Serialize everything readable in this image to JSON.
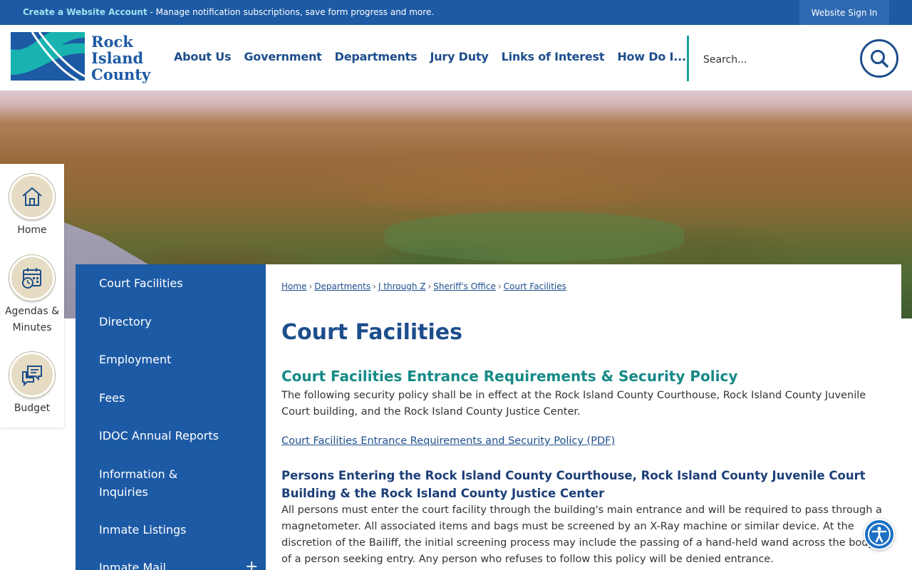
{
  "topbar": {
    "create_account_link": "Create a Website Account",
    "create_account_desc": " - Manage notification subscriptions, save form progress and more.",
    "sign_in": "Website Sign In"
  },
  "logo": {
    "line1": "Rock",
    "line2": "Island",
    "line3": "County"
  },
  "nav": {
    "items": [
      "About Us",
      "Government",
      "Departments",
      "Jury Duty",
      "Links of Interest",
      "How Do I..."
    ]
  },
  "search": {
    "placeholder": "Search...",
    "icon": "search-icon"
  },
  "quick_links": [
    {
      "label": "Home",
      "icon": "home-icon"
    },
    {
      "label": "Agendas & Minutes",
      "icon": "calendar-clock-icon"
    },
    {
      "label": "Budget",
      "icon": "chat-bubbles-icon"
    }
  ],
  "sidenav": {
    "items": [
      "Court Facilities",
      "Directory",
      "Employment",
      "Fees",
      "IDOC Annual Reports",
      "Information & Inquiries",
      "Inmate Listings",
      "Inmate Mail"
    ],
    "expand_symbol": "+"
  },
  "breadcrumb": {
    "items": [
      "Home",
      "Departments",
      "J through Z",
      "Sheriff's Office",
      "Court Facilities"
    ],
    "separator": "›"
  },
  "content": {
    "title": "Court Facilities",
    "section_heading": "Court Facilities Entrance Requirements & Security Policy",
    "intro": "The following security policy shall be in effect at the Rock Island County Courthouse, Rock Island County Juvenile Court building, and the Rock Island County Justice Center.",
    "pdf_link": "Court Facilities Entrance Requirements and Security Policy (PDF)",
    "subheading": "Persons Entering the Rock Island County Courthouse, Rock Island County Juvenile Court Building & the Rock Island County Justice Center",
    "body": "All persons must enter the court facility through the building's main entrance and will be required to pass through a magnetometer. All associated items and bags must be screened by an X-Ray machine or similar device. At the discretion of the Bailiff, the initial screening process may include the passing of a hand-held wand across the body of a person seeking entry. Any person who refuses to follow this policy will be denied entrance."
  },
  "accessibility": {
    "icon": "accessibility-icon"
  },
  "colors": {
    "primary_blue": "#1d5aa5",
    "nav_text": "#1d4e8c",
    "teal_accent": "#168a86",
    "quick_link_circle": "#e5dcc3"
  }
}
